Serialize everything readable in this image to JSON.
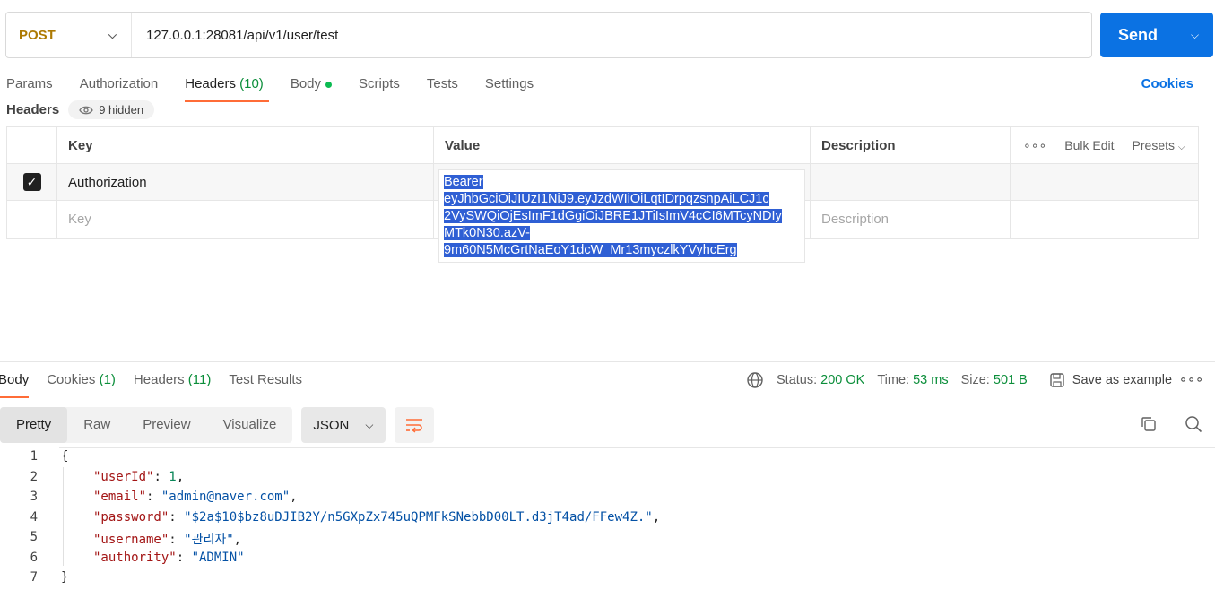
{
  "request": {
    "method": "POST",
    "url": "127.0.0.1:28081/api/v1/user/test",
    "send_label": "Send"
  },
  "tabs": [
    {
      "label": "Params"
    },
    {
      "label": "Authorization"
    },
    {
      "label": "Headers",
      "count": "(10)"
    },
    {
      "label": "Body"
    },
    {
      "label": "Scripts"
    },
    {
      "label": "Tests"
    },
    {
      "label": "Settings"
    }
  ],
  "cookies_link": "Cookies",
  "headers_section": {
    "title": "Headers",
    "hidden": "9 hidden"
  },
  "table": {
    "columns": [
      "Key",
      "Value",
      "Description"
    ],
    "bulk_edit": "Bulk Edit",
    "presets": "Presets",
    "row": {
      "key": "Authorization",
      "value_lines": [
        "Bearer",
        "eyJhbGciOiJIUzI1NiJ9.eyJzdWIiOiLqtIDrpqzsnpAiLCJ1c",
        "2VySWQiOjEsImF1dGgiOiJBRE1JTiIsImV4cCI6MTcyNDIy",
        "MTk0N30.azV-",
        "9m60N5McGrtNaEoY1dcW_Mr13myczlkYVyhcErg"
      ]
    },
    "placeholder": {
      "key": "Key",
      "description": "Description"
    }
  },
  "response": {
    "tabs": [
      {
        "label": "Body"
      },
      {
        "label": "Cookies",
        "count": "(1)"
      },
      {
        "label": "Headers",
        "count": "(11)"
      },
      {
        "label": "Test Results"
      }
    ],
    "status_label": "Status:",
    "status_value": "200 OK",
    "time_label": "Time:",
    "time_value": "53 ms",
    "size_label": "Size:",
    "size_value": "501 B",
    "save_example": "Save as example",
    "views": [
      "Pretty",
      "Raw",
      "Preview",
      "Visualize"
    ],
    "format": "JSON"
  },
  "code": {
    "line_numbers": [
      "1",
      "2",
      "3",
      "4",
      "5",
      "6",
      "7"
    ],
    "open": "{",
    "close": "}",
    "fields": [
      {
        "k": "\"userId\"",
        "v": "1",
        "type": "num",
        "comma": ","
      },
      {
        "k": "\"email\"",
        "v": "\"admin@naver.com\"",
        "type": "str",
        "comma": ","
      },
      {
        "k": "\"password\"",
        "v": "\"$2a$10$bz8uDJIB2Y/n5GXpZx745uQPMFkSNebbD00LT.d3jT4ad/FFew4Z.\"",
        "type": "str",
        "comma": ","
      },
      {
        "k": "\"username\"",
        "v": "\"관리자\"",
        "type": "str",
        "comma": ","
      },
      {
        "k": "\"authority\"",
        "v": "\"ADMIN\"",
        "type": "str",
        "comma": ""
      }
    ]
  },
  "colors": {
    "accent": "#ff6c37",
    "send": "#0b72e3",
    "method": "#ad7a03",
    "status_ok": "#0b8e3a"
  }
}
